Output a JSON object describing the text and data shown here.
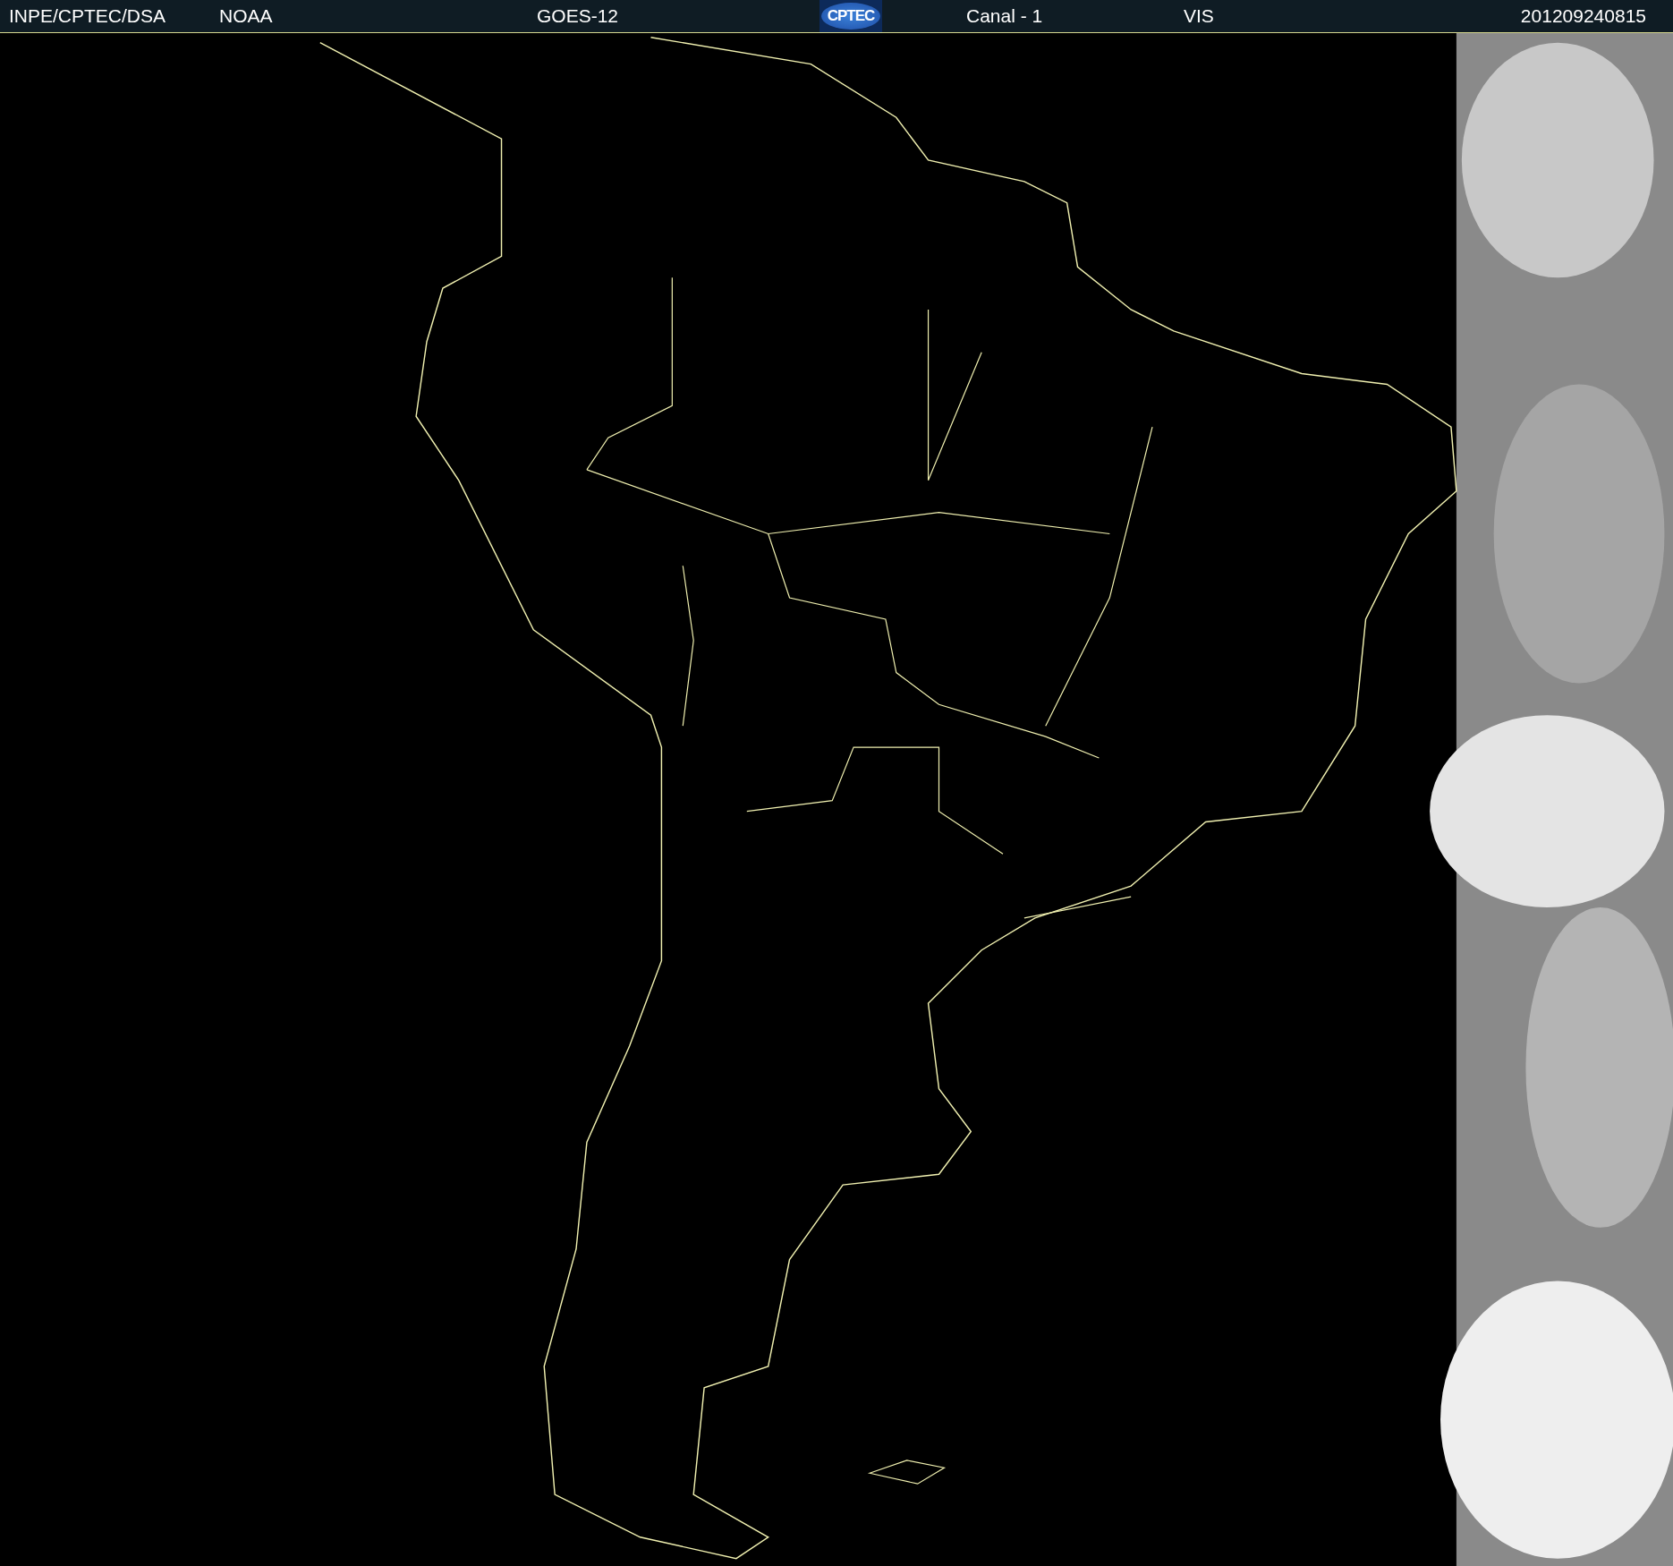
{
  "header": {
    "labels": [
      "INPE/CPTEC/DSA",
      "NOAA",
      "GOES-12"
    ],
    "logo_text": "CPTEC",
    "channel": "Canal - 1",
    "band": "VIS",
    "timestamp": "201209240815"
  }
}
